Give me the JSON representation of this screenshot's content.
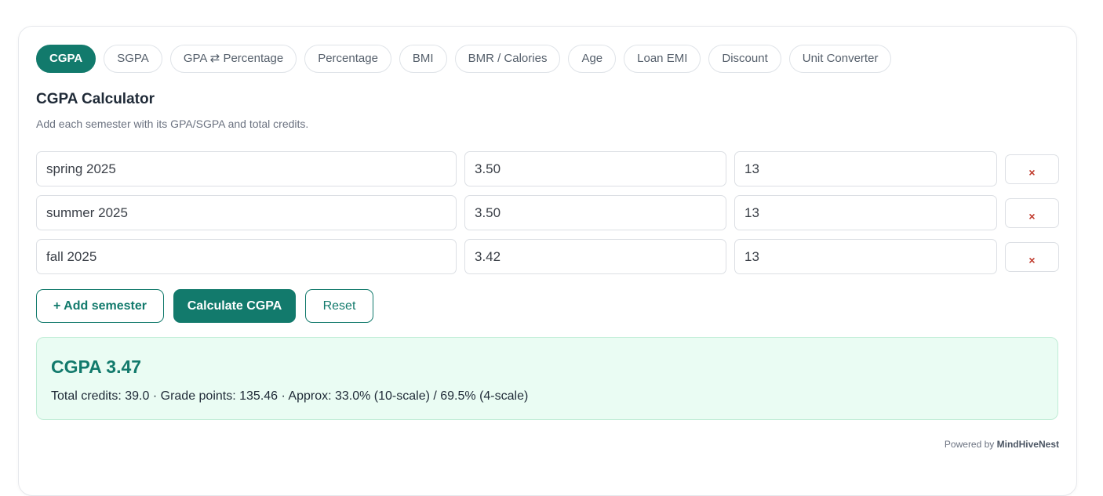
{
  "tabs": [
    {
      "label": "CGPA",
      "active": true
    },
    {
      "label": "SGPA"
    },
    {
      "label": "GPA ⇄ Percentage"
    },
    {
      "label": "Percentage"
    },
    {
      "label": "BMI"
    },
    {
      "label": "BMR / Calories"
    },
    {
      "label": "Age"
    },
    {
      "label": "Loan EMI"
    },
    {
      "label": "Discount"
    },
    {
      "label": "Unit Converter"
    }
  ],
  "calculator": {
    "title": "CGPA Calculator",
    "subtitle": "Add each semester with its GPA/SGPA and total credits."
  },
  "semesters": [
    {
      "name": "spring 2025",
      "gpa": "3.50",
      "credits": "13",
      "remove_icon": "×"
    },
    {
      "name": "summer 2025",
      "gpa": "3.50",
      "credits": "13",
      "remove_icon": "×"
    },
    {
      "name": "fall 2025",
      "gpa": "3.42",
      "credits": "13",
      "remove_icon": "×"
    }
  ],
  "actions": {
    "add_label": "+ Add semester",
    "calculate_label": "Calculate CGPA",
    "reset_label": "Reset"
  },
  "result": {
    "title": "CGPA 3.47",
    "details": "Total credits: 39.0 · Grade points: 135.46 · Approx: 33.0% (10-scale) / 69.5% (4-scale)"
  },
  "footer": {
    "powered_prefix": "Powered by",
    "brand": "MindHiveNest"
  },
  "colors": {
    "accent": "#127a6c",
    "result_bg": "#eafcf3",
    "remove": "#c0392b"
  }
}
